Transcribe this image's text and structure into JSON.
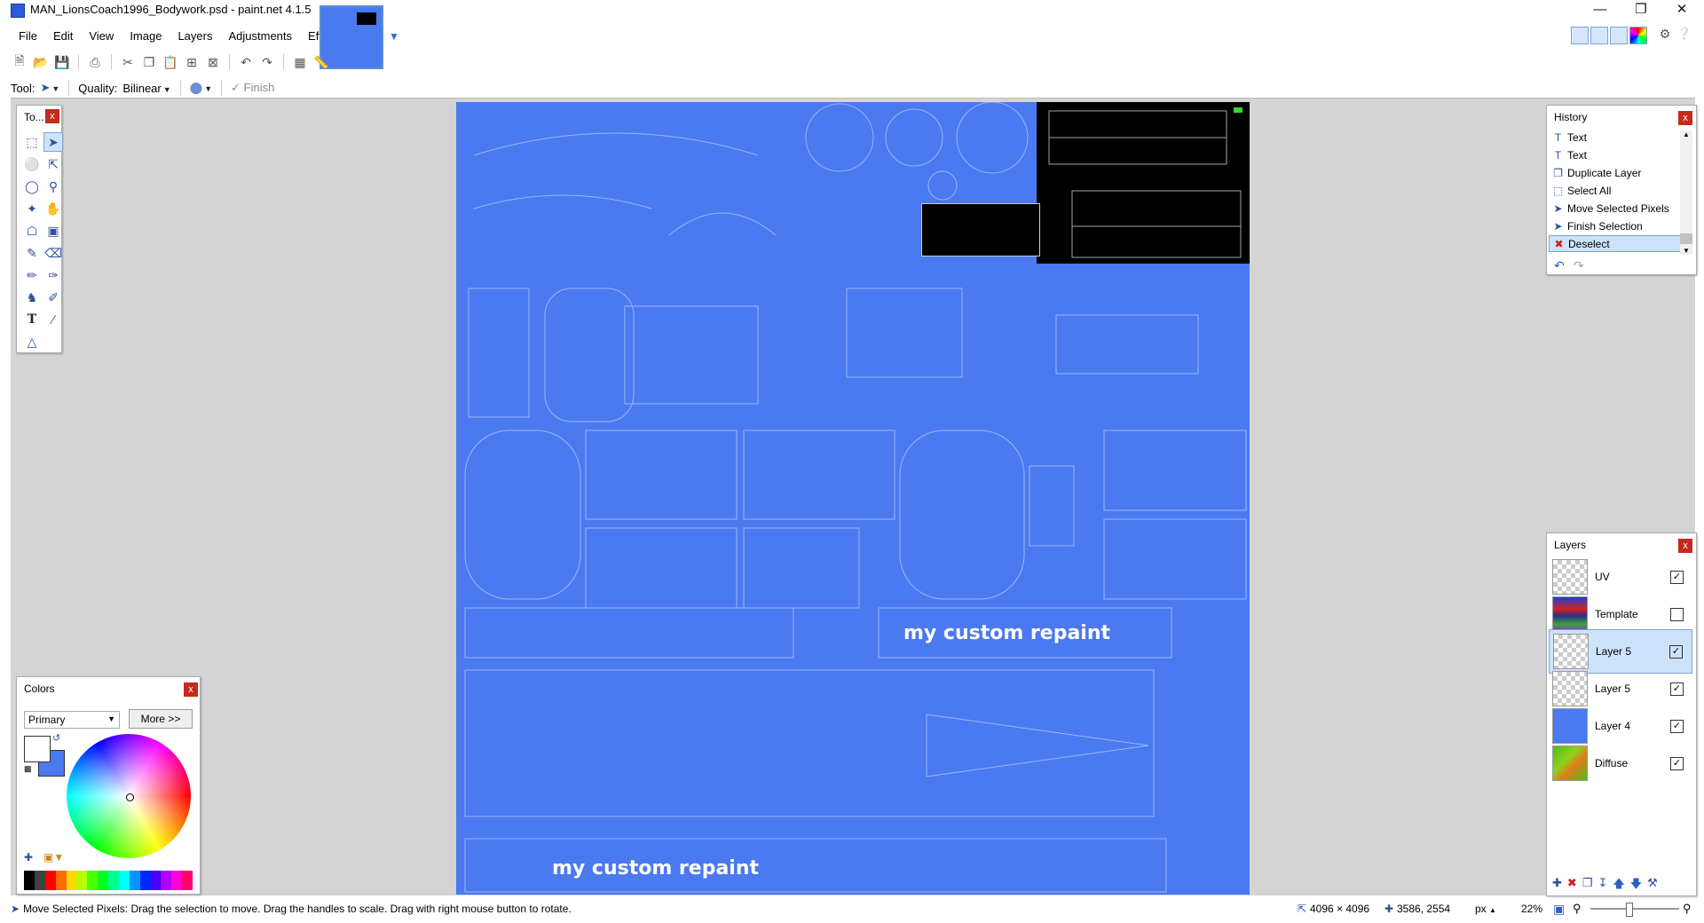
{
  "window": {
    "title": "MAN_LionsCoach1996_Bodywork.psd - paint.net 4.1.5"
  },
  "menu": [
    "File",
    "Edit",
    "View",
    "Image",
    "Layers",
    "Adjustments",
    "Effects"
  ],
  "tool_options": {
    "tool_label": "Tool:",
    "quality_label": "Quality:",
    "quality_value": "Bilinear",
    "finish_label": "Finish"
  },
  "canvas": {
    "text_1": "my custom repaint",
    "text_2": "my custom repaint",
    "fill_color": "#4a79f0"
  },
  "tools_panel": {
    "title": "To..."
  },
  "colors_panel": {
    "title": "Colors",
    "mode": "Primary",
    "more_button": "More >>",
    "primary_color": "#ffffff",
    "secondary_color": "#4a79f0",
    "palette": [
      "#000000",
      "#404040",
      "#ff0000",
      "#ff6a00",
      "#ffd800",
      "#b6ff00",
      "#4cff00",
      "#00ff21",
      "#00ff90",
      "#00ffff",
      "#0094ff",
      "#0026ff",
      "#4800ff",
      "#b200ff",
      "#ff00dc",
      "#ff006e"
    ]
  },
  "history_panel": {
    "title": "History",
    "items": [
      {
        "label": "Text",
        "icon": "text-icon"
      },
      {
        "label": "Text",
        "icon": "text-icon"
      },
      {
        "label": "Duplicate Layer",
        "icon": "duplicate-layer-icon"
      },
      {
        "label": "Select All",
        "icon": "select-all-icon"
      },
      {
        "label": "Move Selected Pixels",
        "icon": "move-pixels-icon"
      },
      {
        "label": "Finish Selection",
        "icon": "move-selection-icon"
      },
      {
        "label": "Deselect",
        "icon": "deselect-icon"
      }
    ],
    "selected_index": 6
  },
  "layers_panel": {
    "title": "Layers",
    "layers": [
      {
        "name": "UV",
        "visible": true,
        "thumb": "checker"
      },
      {
        "name": "Template",
        "visible": false,
        "thumb": "template"
      },
      {
        "name": "Layer 5",
        "visible": true,
        "thumb": "checker"
      },
      {
        "name": "Layer 5",
        "visible": true,
        "thumb": "checker"
      },
      {
        "name": "Layer 4",
        "visible": true,
        "thumb": "blue"
      },
      {
        "name": "Diffuse",
        "visible": true,
        "thumb": "diffuse"
      }
    ],
    "selected_index": 2
  },
  "status": {
    "hint": "Move Selected Pixels: Drag the selection to move. Drag the handles to scale. Drag with right mouse button to rotate.",
    "image_size": "4096 × 4096",
    "cursor_pos": "3586, 2554",
    "units": "px",
    "zoom": "22%"
  }
}
